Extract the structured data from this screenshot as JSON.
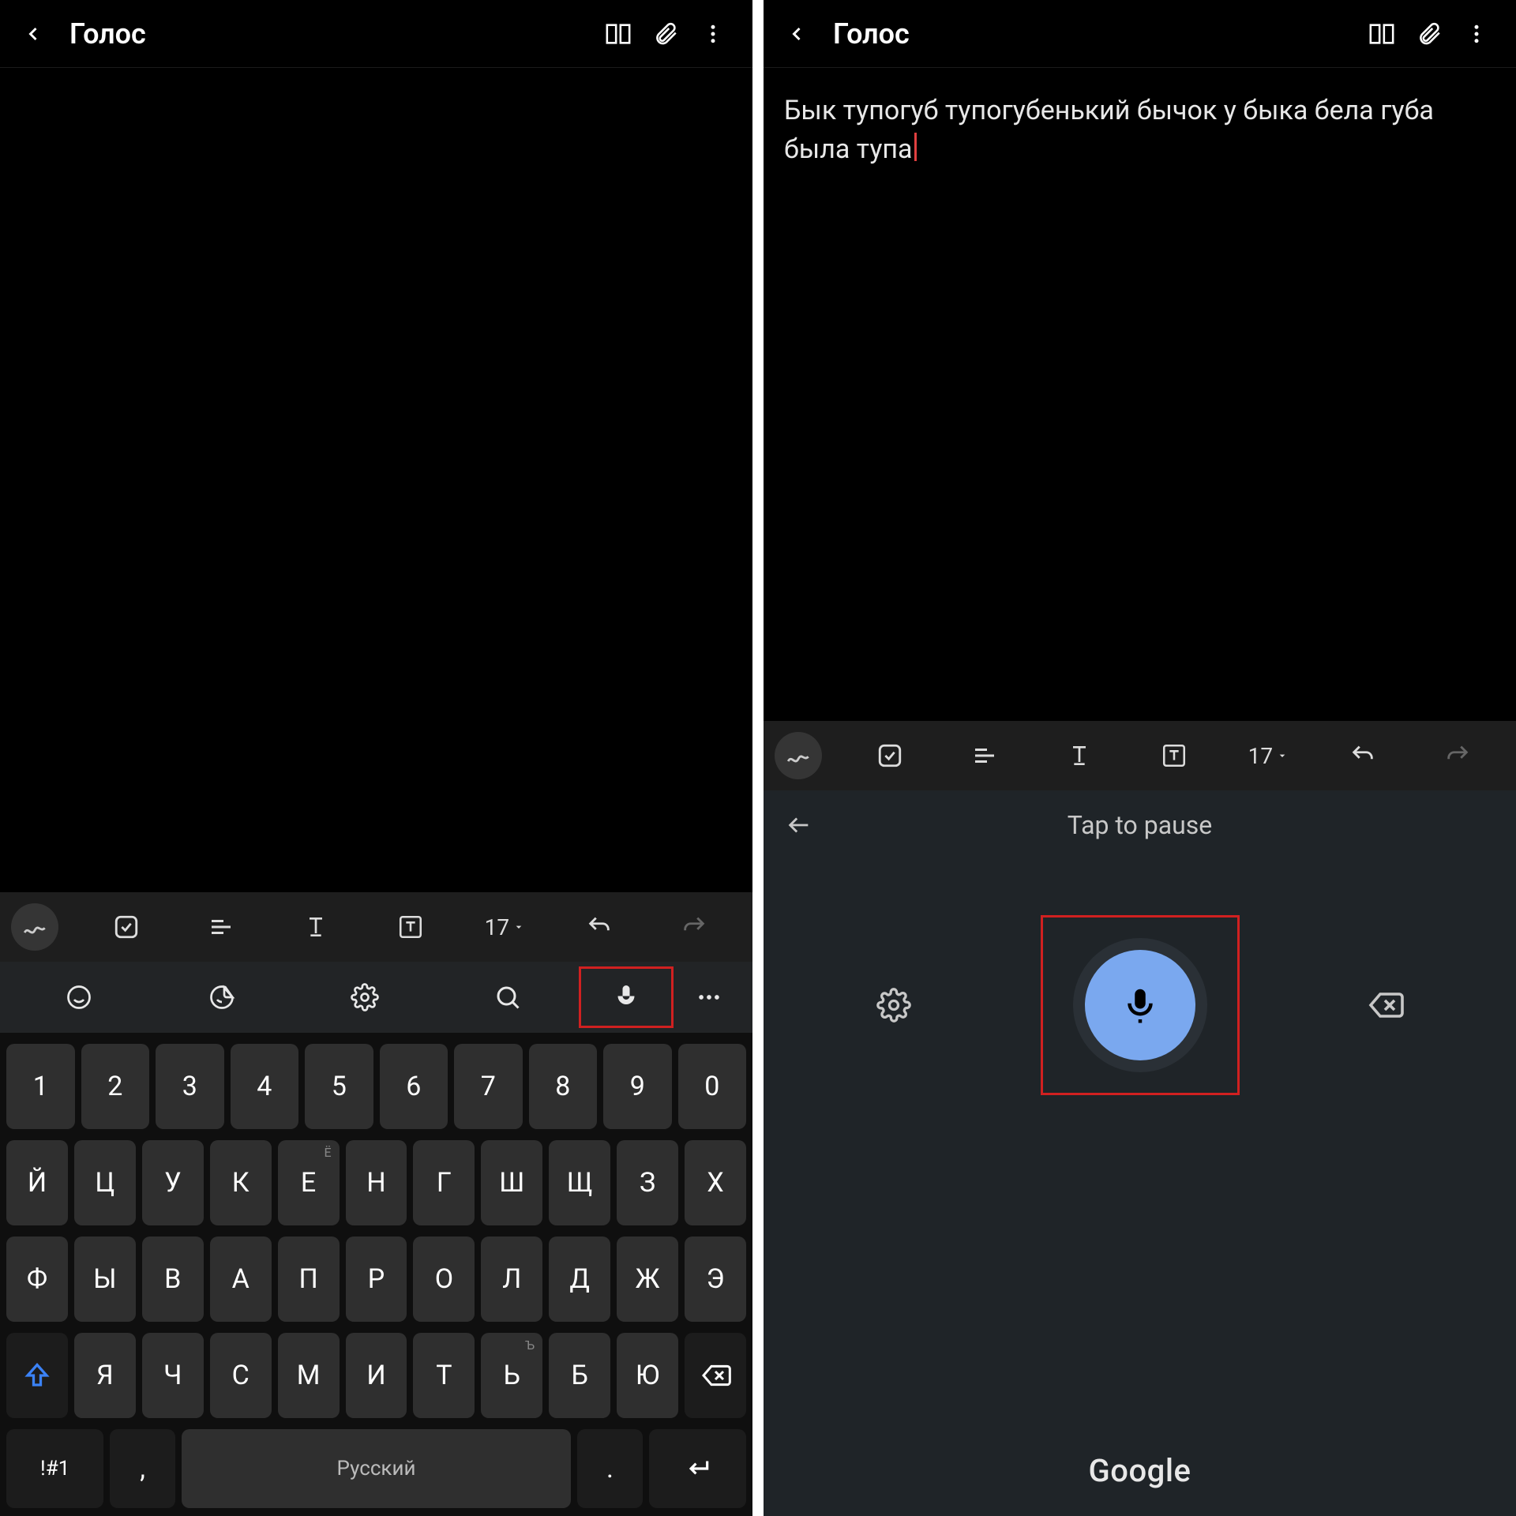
{
  "left": {
    "header": {
      "title": "Голос"
    },
    "format_toolbar": {
      "font_size": "17"
    },
    "keyboard": {
      "row_num": [
        "1",
        "2",
        "3",
        "4",
        "5",
        "6",
        "7",
        "8",
        "9",
        "0"
      ],
      "row1": [
        "Й",
        "Ц",
        "У",
        "К",
        "Е",
        "Н",
        "Г",
        "Ш",
        "Щ",
        "З",
        "Х"
      ],
      "row1_hints": {
        "4": "Ё"
      },
      "row2": [
        "Ф",
        "Ы",
        "В",
        "А",
        "П",
        "Р",
        "О",
        "Л",
        "Д",
        "Ж",
        "Э"
      ],
      "row3": [
        "Я",
        "Ч",
        "С",
        "М",
        "И",
        "Т",
        "Ь",
        "Б",
        "Ю"
      ],
      "row3_hints": {
        "6": "Ъ"
      },
      "bottom": {
        "sym": "!#1",
        "comma": ",",
        "space": "Русский",
        "period": "."
      }
    }
  },
  "right": {
    "header": {
      "title": "Голос"
    },
    "content_text": "Бык тупогуб тупогубенький бычок у быка бела губа была тупа",
    "format_toolbar": {
      "font_size": "17"
    },
    "voice": {
      "hint": "Tap to pause",
      "brand": "Google"
    }
  }
}
